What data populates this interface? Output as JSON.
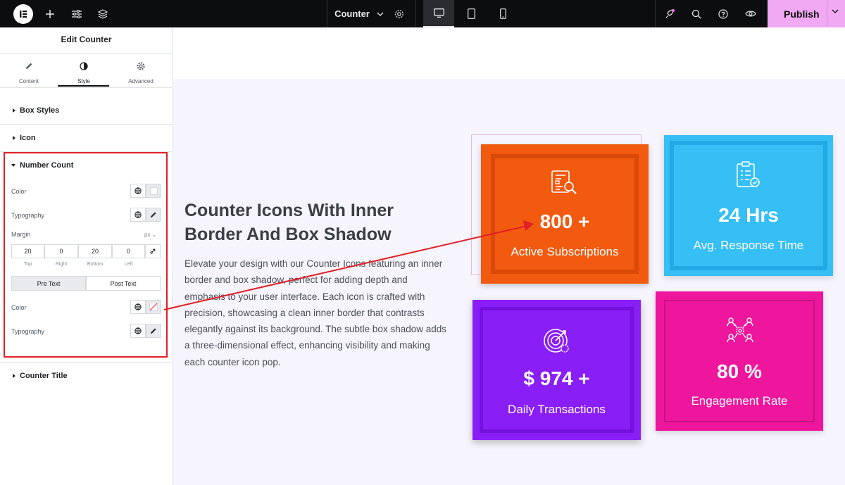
{
  "topbar": {
    "document_title": "Counter",
    "publish_label": "Publish"
  },
  "panel": {
    "title": "Edit Counter",
    "tabs": [
      {
        "label": "Content"
      },
      {
        "label": "Style"
      },
      {
        "label": "Advanced"
      }
    ],
    "sections": {
      "box_styles": "Box Styles",
      "icon": "Icon",
      "number_count": "Number Count",
      "counter_title": "Counter Title"
    },
    "controls": {
      "color_label": "Color",
      "typography_label": "Typography",
      "margin_label": "Margin",
      "unit": "px",
      "margin_values": {
        "top": "20",
        "right": "0",
        "bottom": "20",
        "left": "0"
      },
      "margin_labels": {
        "top": "Top",
        "right": "Right",
        "bottom": "Bottom",
        "left": "Left"
      },
      "pre_text": "Pre Text",
      "post_text": "Post Text",
      "color_label_2": "Color",
      "typography_label_2": "Typography"
    }
  },
  "canvas": {
    "heading": "Counter Icons With Inner Border And Box Shadow",
    "description": "Elevate your design with our Counter Icons featuring an inner border and box shadow, perfect for adding depth and emphasis to your user interface. Each icon is crafted with precision, showcasing a clean inner border that contrasts elegantly against its background. The subtle box shadow adds a three-dimensional effect, enhancing visibility and making each counter icon pop.",
    "cards": [
      {
        "number": "800 +",
        "label": "Active Subscriptions",
        "color": "#f15a0f",
        "icon": "report-search-icon"
      },
      {
        "number": "24 Hrs",
        "label": "Avg. Response Time",
        "color": "#35bff5",
        "icon": "clipboard-check-icon"
      },
      {
        "number": "$ 974 +",
        "label": "Daily Transactions",
        "color": "#8a1ef7",
        "icon": "target-gear-icon"
      },
      {
        "number": "80 %",
        "label": "Engagement Rate",
        "color": "#ee169d",
        "icon": "team-network-icon"
      }
    ]
  },
  "colors": {
    "accent_pink": "#f0a9f2",
    "highlight_red": "#e01f26",
    "topbar": "#0c0d0e"
  }
}
